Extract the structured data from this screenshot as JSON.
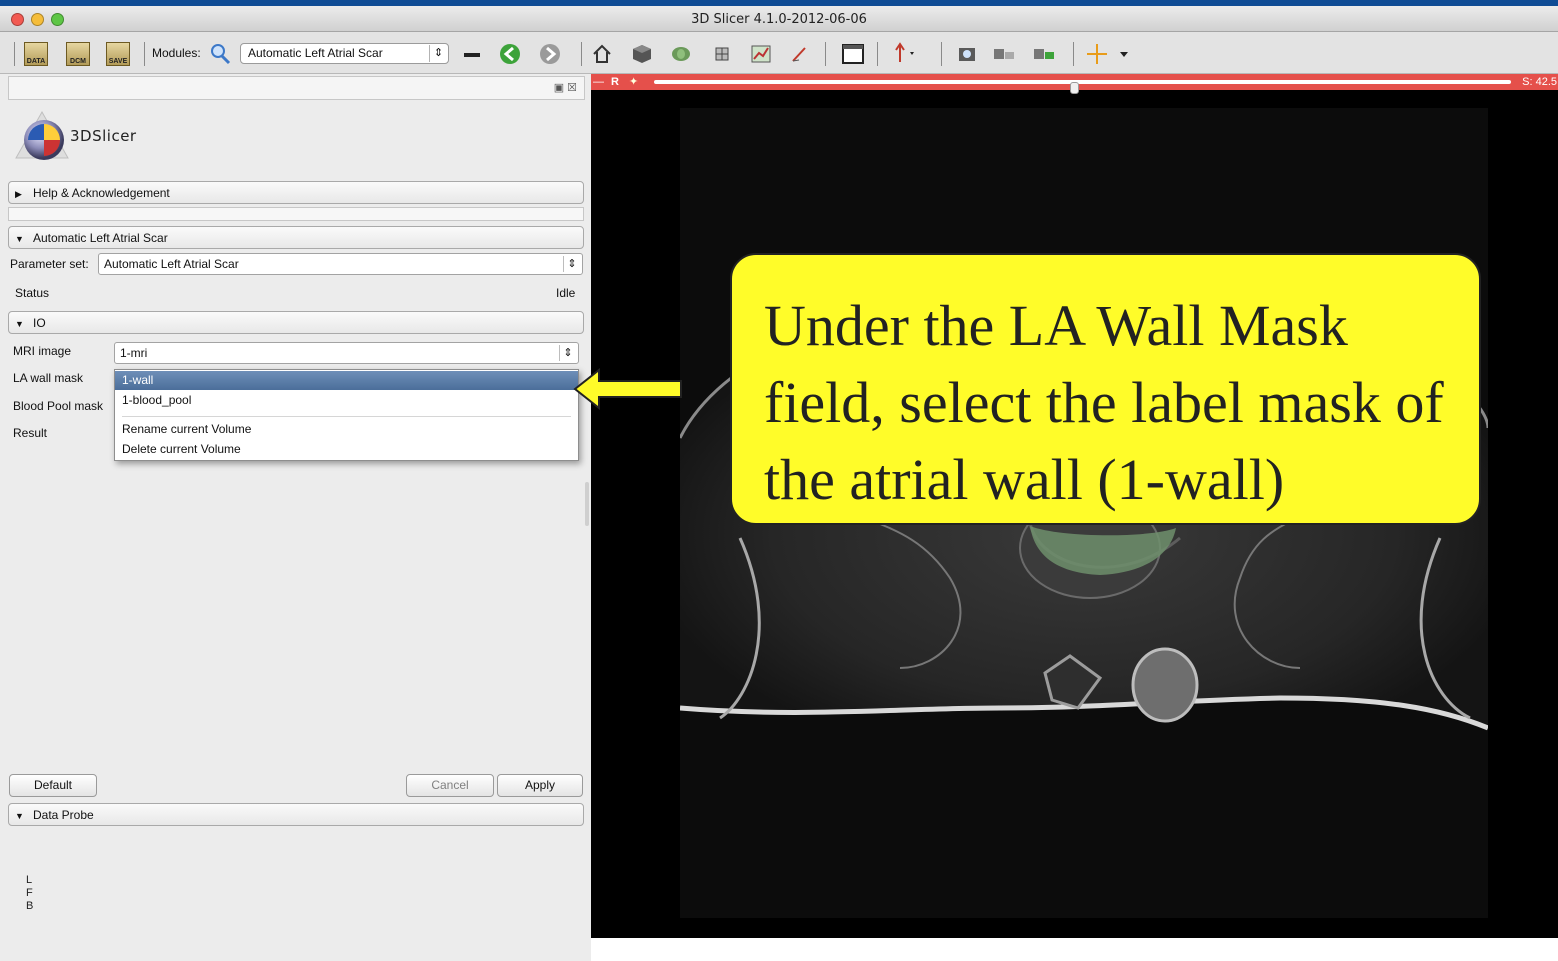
{
  "window": {
    "title": "3D Slicer 4.1.0-2012-06-06"
  },
  "toolbar": {
    "modules_label": "Modules:",
    "module_selected": "Automatic Left Atrial Scar",
    "icons": [
      "data-icon",
      "dcm-icon",
      "save-icon",
      "search-icon",
      "minimize-icon",
      "back-arrow-icon",
      "forward-arrow-icon",
      "home-icon",
      "cube-icon",
      "brain-icon",
      "models-icon",
      "chart-icon",
      "editor-icon",
      "layout-icon",
      "mouse-mode-icon",
      "screenshot-icon",
      "crosshair-icon"
    ],
    "data_label": "DATA",
    "dcm_label": "DCM",
    "save_label": "SAVE"
  },
  "panel": {
    "logo_text": "3DSlicer",
    "help_section": "Help & Acknowledgement",
    "module_section": "Automatic Left Atrial Scar",
    "parameter_set_label": "Parameter set:",
    "parameter_set_value": "Automatic Left Atrial Scar",
    "status_label": "Status",
    "status_value": "Idle",
    "io_section": "IO",
    "fields": {
      "mri_label": "MRI image",
      "mri_value": "1-mri",
      "wall_label": "LA wall mask",
      "blood_label": "Blood Pool mask",
      "result_label": "Result"
    },
    "dropdown": {
      "items": [
        "1-wall",
        "1-blood_pool"
      ],
      "actions": [
        "Rename current Volume",
        "Delete current Volume"
      ]
    },
    "buttons": {
      "default": "Default",
      "cancel": "Cancel",
      "apply": "Apply"
    },
    "data_probe_section": "Data Probe",
    "coords": [
      "L",
      "F",
      "B"
    ]
  },
  "viewer": {
    "slice_label": "R",
    "slice_value": "S: 42.5",
    "slider_fraction": 0.49,
    "color": "#e5504b"
  },
  "callout": {
    "text": "Under the LA Wall Mask field, select the label mask of the atrial wall (1-wall)",
    "color": "#fffc29"
  }
}
